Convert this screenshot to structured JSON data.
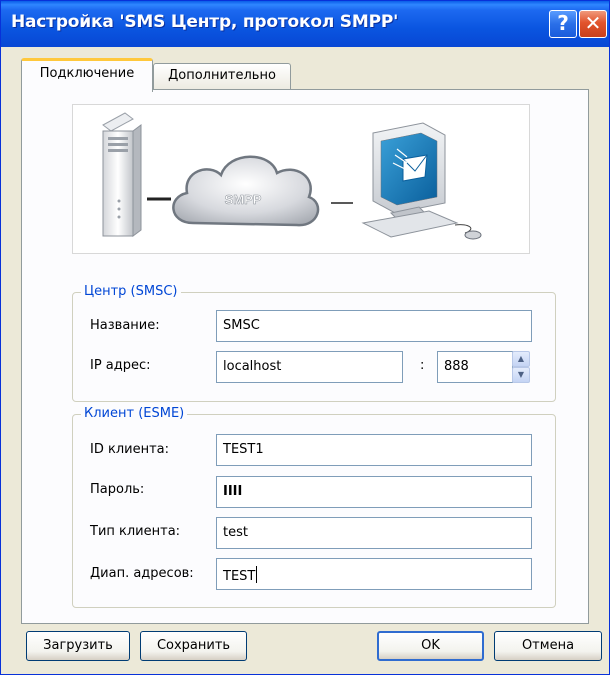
{
  "window": {
    "title": "Настройка 'SMS Центр, протокол SMPP'",
    "help_glyph": "?",
    "close_glyph": "✕"
  },
  "tabs": [
    {
      "label": "Подключение",
      "active": true
    },
    {
      "label": "Дополнительно",
      "active": false
    }
  ],
  "illustration": {
    "cloud_label": "SMPP"
  },
  "smsc": {
    "title": "Центр (SMSC)",
    "name_label": "Название:",
    "name_value": "SMSC",
    "ip_label": "IP адрес:",
    "ip_value": "localhost",
    "port_separator": ":",
    "port_value": "888"
  },
  "esme": {
    "title": "Клиент (ESME)",
    "id_label": "ID клиента:",
    "id_value": "TEST1",
    "password_label": "Пароль:",
    "password_value": "IIII",
    "type_label": "Тип клиента:",
    "type_value": "test",
    "range_label": "Диап. адресов:",
    "range_value": "TEST"
  },
  "buttons": {
    "load": "Загрузить",
    "save": "Сохранить",
    "ok": "OK",
    "cancel": "Отмена"
  },
  "colors": {
    "titlebar": "#0a55e0",
    "group_title": "#0046d5",
    "tab_highlight": "#ffc83c",
    "dialog_bg": "#ece9d8"
  }
}
